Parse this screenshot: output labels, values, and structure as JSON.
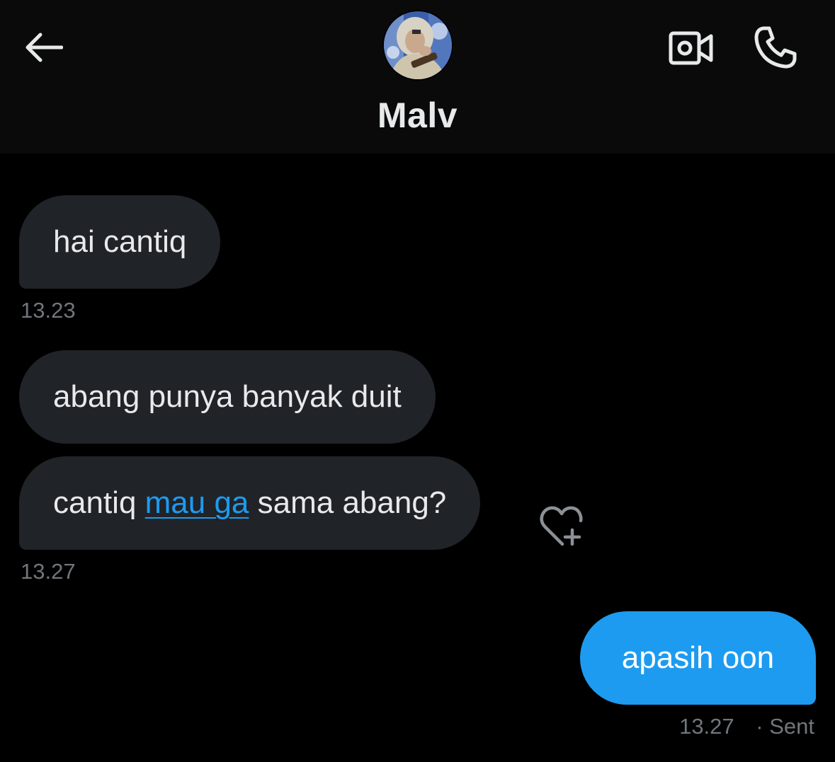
{
  "header": {
    "contact_name": "Malv",
    "icons": {
      "back": "arrow-left-icon",
      "video": "video-camera-icon",
      "call": "phone-icon"
    }
  },
  "messages": [
    {
      "id": "m1",
      "direction": "incoming",
      "text": "hai cantiq",
      "time": "13.23"
    },
    {
      "id": "m2",
      "direction": "incoming",
      "text": "abang punya banyak duit"
    },
    {
      "id": "m3",
      "direction": "incoming",
      "text_before": "cantiq ",
      "link_text": "mau ga",
      "text_after": " sama abang?",
      "time": "13.27",
      "reaction_icon": "heart-plus-icon"
    },
    {
      "id": "m4",
      "direction": "outgoing",
      "text": "apasih oon",
      "time": "13.27",
      "status": "· Sent"
    }
  ],
  "colors": {
    "background": "#000000",
    "header_bg": "#0a0a0a",
    "incoming_bubble": "#202327",
    "outgoing_bubble": "#1d9bf0",
    "link": "#1d9bf0",
    "timestamp": "#71767b"
  }
}
